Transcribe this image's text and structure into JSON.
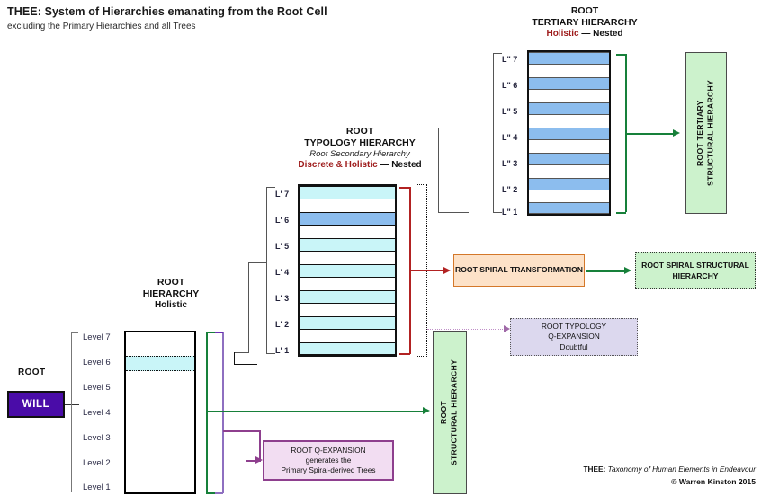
{
  "title": "THEE:  System of  Hierarchies emanating from the Root Cell",
  "subtitle": "excluding the Primary Hierarchies and all Trees",
  "colors": {
    "will_purple": "#4a0ca8",
    "cyan_band": "#c9f5f8",
    "blue_band": "#8cbdee",
    "green_fill": "#ccf2cc",
    "green_line": "#17803a",
    "orange_fill": "#fde2c8",
    "orange_line": "#d4782a",
    "lavender_fill": "#dcd8ee",
    "pink_fill": "#f2ddf2",
    "purple_line": "#8e3f8e",
    "red_line": "#b22222",
    "dark_red_text": "#9e1b1b",
    "gray_bracket": "#6e6e6e"
  },
  "root_cell": {
    "label": "ROOT",
    "will_label": "WILL"
  },
  "root_hierarchy": {
    "heading_line1": "ROOT",
    "heading_line2": "HIERARCHY",
    "heading_line3": "Holistic",
    "levels": [
      "Level 7",
      "Level 6",
      "Level 5",
      "Level 4",
      "Level 3",
      "Level 2",
      "Level 1"
    ],
    "highlighted_level": "Level 6"
  },
  "typology_hierarchy": {
    "heading_line1": "ROOT",
    "heading_line2": "TYPOLOGY HIERARCHY",
    "heading_line3": "Root Secondary Hierarchy",
    "heading_line4_red": "Discrete & Holistic",
    "heading_line4_rest": " — Nested",
    "levels": [
      "L' 7",
      "L' 6",
      "L' 5",
      "L' 4",
      "L' 3",
      "L' 2",
      "L' 1"
    ],
    "highlighted_level": "L' 6"
  },
  "tertiary_hierarchy": {
    "heading_line1": "ROOT",
    "heading_line2": "TERTIARY HIERARCHY",
    "heading_line3_red": "Holistic",
    "heading_line3_rest": " — Nested",
    "levels": [
      "L\" 7",
      "L\" 6",
      "L\" 5",
      "L\" 4",
      "L\" 3",
      "L\" 2",
      "L\" 1"
    ]
  },
  "boxes": {
    "root_structural_hierarchy": "ROOT\nSTRUCTURAL HIERARCHY",
    "root_tertiary_structural_hierarchy": "ROOT TERTIARY\nSTRUCTURAL HIERARCHY",
    "root_spiral_transformation": "ROOT SPIRAL TRANSFORMATION",
    "root_spiral_structural_hierarchy": "ROOT SPIRAL STRUCTURAL\nHIERARCHY",
    "root_typology_q_expansion": "ROOT TYPOLOGY\nQ-EXPANSION\nDoubtful",
    "root_q_expansion": "ROOT Q-EXPANSION\ngenerates the\nPrimary Spiral-derived Trees"
  },
  "footer": {
    "line1_bold": "THEE:",
    "line1_italic": " Taxonomy of Human Elements in Endeavour",
    "line2": "© Warren Kinston 2015"
  }
}
